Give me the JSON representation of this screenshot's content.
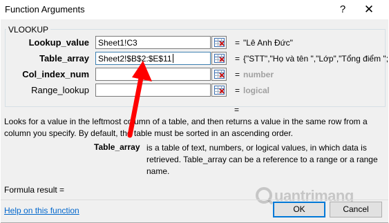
{
  "window": {
    "title": "Function Arguments",
    "help_glyph": "?",
    "close_glyph": "✕"
  },
  "function_name": "VLOOKUP",
  "arguments": [
    {
      "label": "Lookup_value",
      "value": "Sheet1!C3",
      "result": "\"Lê Anh Đức\""
    },
    {
      "label": "Table_array",
      "value": "Sheet2!$B$2:$E$11",
      "result": "{\"STT\",\"Họ và tên \",\"Lớp\",\"Tổng điểm \";:"
    },
    {
      "label": "Col_index_num",
      "value": "",
      "result": "number"
    },
    {
      "label": "Range_lookup",
      "value": "",
      "result": "logical"
    }
  ],
  "equals": "=",
  "result_equals": "=",
  "description": "Looks for a value in the leftmost column of a table, and then returns a value in the same row from a column you specify. By default, the table must be sorted in an ascending order.",
  "arg_help": {
    "name": "Table_array",
    "text": "is a table of text, numbers, or logical values, in which data is retrieved. Table_array can be a reference to a range or a range name."
  },
  "formula_result_label": "Formula result =",
  "help_link": "Help on this function",
  "buttons": {
    "ok": "OK",
    "cancel": "Cancel"
  },
  "watermark": "Quantrimang",
  "colors": {
    "arrow": "#ff0000",
    "link": "#0066cc",
    "dialog_bg": "#f0f0f0"
  },
  "icons": {
    "ref_picker": "collapse-range-icon"
  }
}
